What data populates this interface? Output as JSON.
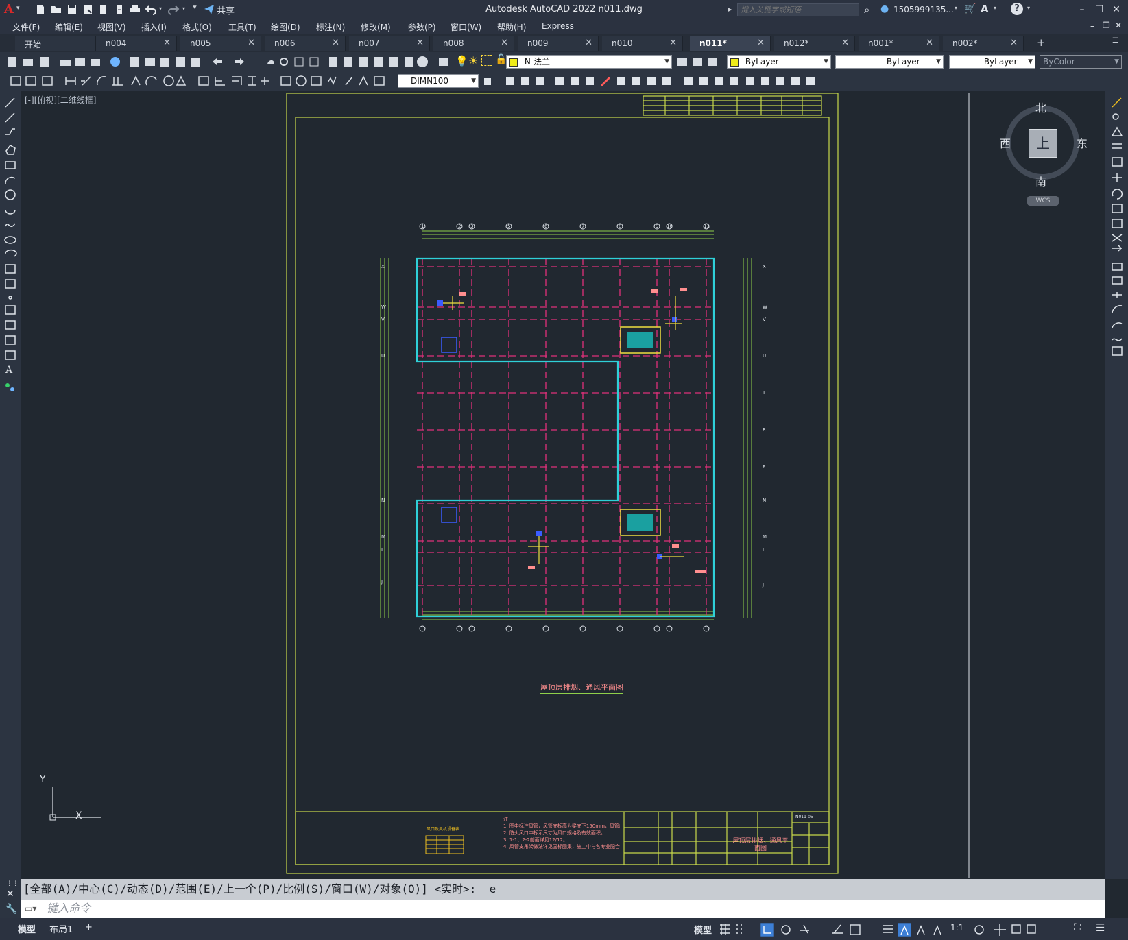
{
  "app": {
    "title": "Autodesk AutoCAD 2022    n011.dwg",
    "share_label": "共享",
    "search_placeholder": "键入关键字或短语",
    "user_name": "1505999135...",
    "logo": "A"
  },
  "menus": [
    "文件(F)",
    "编辑(E)",
    "视图(V)",
    "插入(I)",
    "格式(O)",
    "工具(T)",
    "绘图(D)",
    "标注(N)",
    "修改(M)",
    "参数(P)",
    "窗口(W)",
    "帮助(H)",
    "Express"
  ],
  "tabs": [
    {
      "label": "开始",
      "closable": false,
      "active": false
    },
    {
      "label": "n004",
      "closable": true,
      "active": false
    },
    {
      "label": "n005",
      "closable": true,
      "active": false
    },
    {
      "label": "n006",
      "closable": true,
      "active": false
    },
    {
      "label": "n007",
      "closable": true,
      "active": false
    },
    {
      "label": "n008",
      "closable": true,
      "active": false
    },
    {
      "label": "n009",
      "closable": true,
      "active": false
    },
    {
      "label": "n010",
      "closable": true,
      "active": false
    },
    {
      "label": "n011*",
      "closable": true,
      "active": true
    },
    {
      "label": "n012*",
      "closable": true,
      "active": false
    },
    {
      "label": "n001*",
      "closable": true,
      "active": false
    },
    {
      "label": "n002*",
      "closable": true,
      "active": false
    }
  ],
  "toolbar": {
    "layer_name": "N-法兰",
    "color": "ByLayer",
    "linetype": "ByLayer",
    "lineweight": "ByLayer",
    "plotstyle": "ByColor",
    "dimstyle": "DIMN100"
  },
  "viewport": {
    "label": "[-][俯视][二维线框]"
  },
  "viewcube": {
    "north": "北",
    "south": "南",
    "east": "东",
    "west": "西",
    "top": "上",
    "wcs": "WCS"
  },
  "ucs": {
    "x": "X",
    "y": "Y"
  },
  "drawing": {
    "plan_title": "屋顶层排烟、通风平面图",
    "legend_title": "风口及风机设备表",
    "notes_heading": "注",
    "notes": [
      "1. 图中标注风管，风管底标高为梁底下150mm，风管底距梁底为150mm。",
      "2. 防火风口中标示尺寸为风口规格及有效面积。",
      "3. 1-1、2-2剖面详见12/12。",
      "4. 风管支吊架做法详见国标图集，施工中与各专业配合。"
    ],
    "title_block": {
      "drawing_name": "屋顶层排烟、通风平面图",
      "drawing_no": "N011-05"
    },
    "axis_top": [
      "1",
      "2",
      "3",
      "5",
      "6",
      "7",
      "8",
      "9",
      "10",
      "11"
    ],
    "axis_left": [
      "X",
      "W",
      "V",
      "U",
      "N",
      "M",
      "L",
      "J"
    ],
    "axis_right": [
      "X",
      "W",
      "V",
      "U",
      "T",
      "R",
      "P",
      "N",
      "M",
      "L",
      "J"
    ]
  },
  "command": {
    "history": "[全部(A)/中心(C)/动态(D)/范围(E)/上一个(P)/比例(S)/窗口(W)/对象(O)] <实时>: _e",
    "input_placeholder": "键入命令"
  },
  "status": {
    "layout_tabs": [
      "模型",
      "布局1"
    ],
    "model_label": "模型",
    "scale": "1:1"
  },
  "colors": {
    "frame": "#c8d84a",
    "outline": "#2fd0d8",
    "grid": "#e0307a",
    "dim": "#8fd04a",
    "accent": "#d52a2a"
  }
}
